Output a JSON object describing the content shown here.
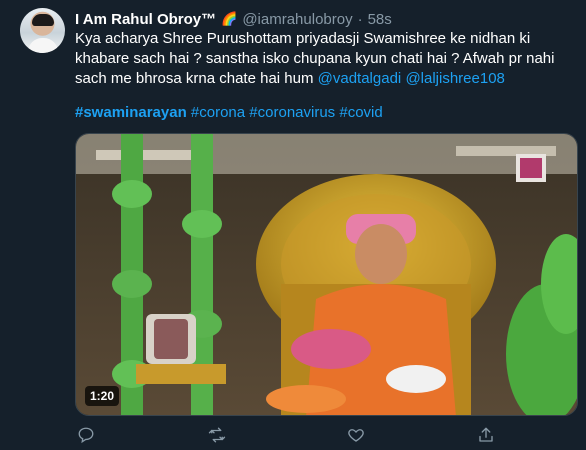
{
  "tweet": {
    "author_name": "I Am Rahul Obroy™",
    "author_emoji": "🌈",
    "handle": "@iamrahulobroy",
    "separator": "·",
    "time": "58s",
    "text_before_mentions": "Kya acharya Shree Purushottam priyadasji Swamishree ke nidhan ki khabare sach hai ? sanstha isko chupana kyun chati hai ? Afwah pr nahi sach me bhrosa krna chate hai hum ",
    "mentions": [
      "@vadtalgadi",
      "@laljishree108"
    ],
    "hashtags": [
      "#swaminarayan",
      "#corona",
      "#coronavirus",
      "#covid"
    ]
  },
  "media": {
    "duration": "1:20"
  },
  "actions": {
    "reply_icon": "reply-icon",
    "retweet_icon": "retweet-icon",
    "like_icon": "heart-icon",
    "share_icon": "share-icon"
  },
  "colors": {
    "background": "#15202b",
    "text": "#ffffff",
    "secondary": "#8899a6",
    "link": "#1da1f2"
  }
}
